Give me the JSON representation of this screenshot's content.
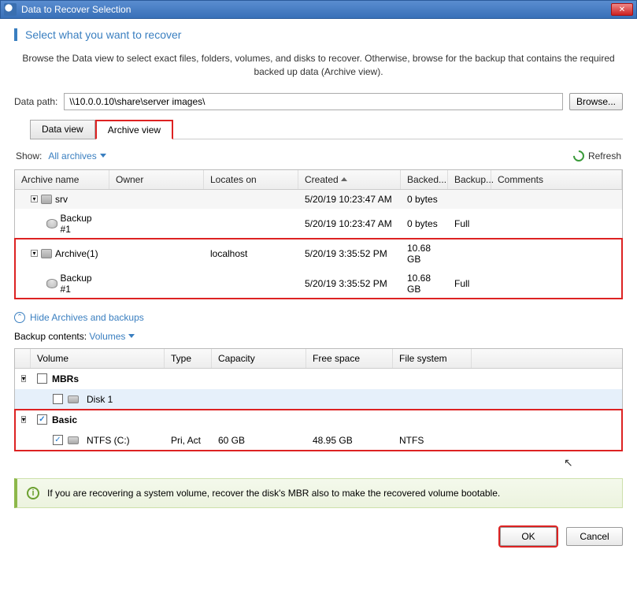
{
  "window": {
    "title": "Data to Recover Selection"
  },
  "instruction": "Select what you want to recover",
  "description": "Browse the Data view to select exact files, folders, volumes, and disks to recover. Otherwise, browse for the backup that contains the required backed up data (Archive view).",
  "datapath": {
    "label": "Data path:",
    "value": "\\\\10.0.0.10\\share\\server images\\",
    "browse": "Browse..."
  },
  "tabs": {
    "data": "Data view",
    "archive": "Archive view"
  },
  "filter": {
    "show_label": "Show:",
    "show_value": "All archives",
    "refresh": "Refresh"
  },
  "archive_columns": {
    "name": "Archive name",
    "owner": "Owner",
    "locates": "Locates on",
    "created": "Created",
    "backed": "Backed...",
    "backupt": "Backup...",
    "comments": "Comments"
  },
  "archives": [
    {
      "name": "srv",
      "owner": "",
      "locates": "",
      "created": "5/20/19 10:23:47 AM",
      "backed": "0 bytes",
      "backupt": "",
      "children": [
        {
          "name": "Backup #1",
          "created": "5/20/19 10:23:47 AM",
          "backed": "0 bytes",
          "backupt": "Full"
        }
      ]
    },
    {
      "name": "Archive(1)",
      "owner": "",
      "locates": "localhost",
      "created": "5/20/19 3:35:52 PM",
      "backed": "10.68 GB",
      "backupt": "",
      "highlight": true,
      "children": [
        {
          "name": "Backup #1",
          "created": "5/20/19 3:35:52 PM",
          "backed": "10.68 GB",
          "backupt": "Full"
        }
      ]
    }
  ],
  "hide_link": "Hide Archives and backups",
  "contents": {
    "label": "Backup contents:",
    "value": "Volumes"
  },
  "vol_columns": {
    "volume": "Volume",
    "type": "Type",
    "capacity": "Capacity",
    "free": "Free space",
    "fs": "File system"
  },
  "vol_groups": [
    {
      "name": "MBRs",
      "checked": false,
      "highlight": false,
      "items": [
        {
          "name": "Disk 1",
          "checked": false,
          "type": "",
          "capacity": "",
          "free": "",
          "fs": "",
          "icon": "disk",
          "blue": true
        }
      ]
    },
    {
      "name": "Basic",
      "checked": true,
      "highlight": true,
      "items": [
        {
          "name": "NTFS (C:)",
          "checked": true,
          "type": "Pri, Act",
          "capacity": "60 GB",
          "free": "48.95 GB",
          "fs": "NTFS",
          "icon": "disk"
        }
      ]
    }
  ],
  "info": "If you are recovering a system volume, recover the disk's MBR also to make the recovered volume bootable.",
  "buttons": {
    "ok": "OK",
    "cancel": "Cancel"
  }
}
